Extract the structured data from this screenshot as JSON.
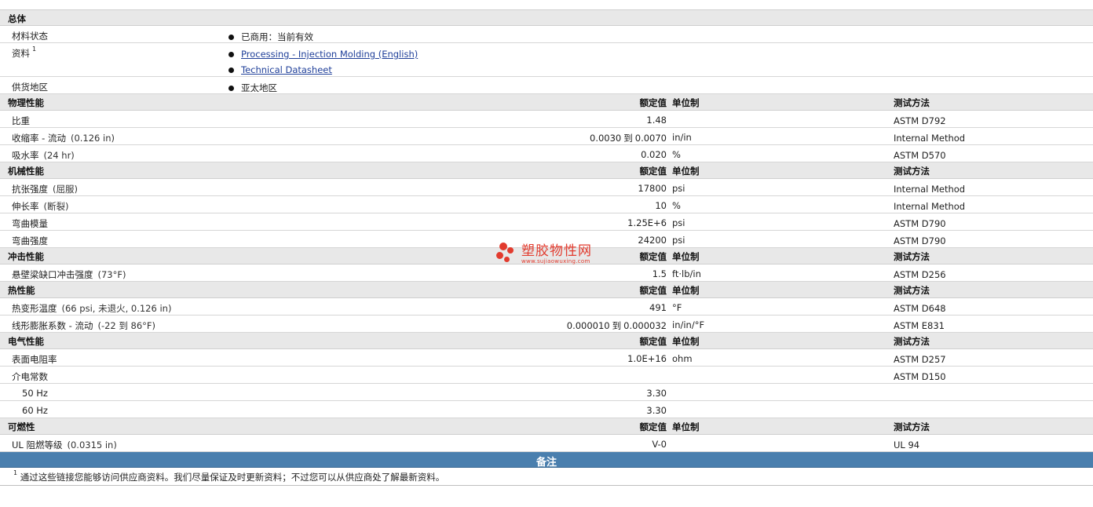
{
  "general": {
    "title": "总体",
    "material_status": {
      "label": "材料状态",
      "value": "已商用：当前有效"
    },
    "docs": {
      "label": "资料",
      "sup": "1",
      "links": [
        "Processing - Injection Molding (English)",
        "Technical Datasheet"
      ]
    },
    "supply": {
      "label": "供货地区",
      "value": "亚太地区"
    }
  },
  "headers": {
    "value": "额定值",
    "unit": "单位制",
    "test": "测试方法"
  },
  "physical": {
    "title": "物理性能",
    "rows": [
      {
        "label": "比重",
        "cond": "",
        "value": "1.48",
        "unit": "",
        "test": "ASTM D792"
      },
      {
        "label": "收缩率 - 流动",
        "cond": "(0.126 in)",
        "v1": "0.0030",
        "to": "到",
        "v2": "0.0070",
        "unit": "in/in",
        "test": "Internal Method"
      },
      {
        "label": "吸水率",
        "cond": "(24 hr)",
        "value": "0.020",
        "unit": "%",
        "test": "ASTM D570"
      }
    ]
  },
  "mechanical": {
    "title": "机械性能",
    "rows": [
      {
        "label": "抗张强度",
        "cond": "(屈服)",
        "value": "17800",
        "unit": "psi",
        "test": "Internal Method"
      },
      {
        "label": "伸长率",
        "cond": "(断裂)",
        "value": "10",
        "unit": "%",
        "test": "Internal Method"
      },
      {
        "label": "弯曲模量",
        "cond": "",
        "value": "1.25E+6",
        "unit": "psi",
        "test": "ASTM D790"
      },
      {
        "label": "弯曲强度",
        "cond": "",
        "value": "24200",
        "unit": "psi",
        "test": "ASTM D790"
      }
    ]
  },
  "impact": {
    "title": "冲击性能",
    "rows": [
      {
        "label": "悬壁梁缺口冲击强度",
        "cond": "(73°F)",
        "value": "1.5",
        "unit": "ft·lb/in",
        "test": "ASTM D256"
      }
    ]
  },
  "thermal": {
    "title": "热性能",
    "rows": [
      {
        "label": "热变形温度",
        "cond": "(66 psi, 未退火, 0.126 in)",
        "value": "491",
        "unit": "°F",
        "test": "ASTM D648"
      },
      {
        "label": "线形膨胀系数 - 流动",
        "cond": "(-22 到 86°F)",
        "v1": "0.000010",
        "to": "到",
        "v2": "0.000032",
        "unit": "in/in/°F",
        "test": "ASTM E831"
      }
    ]
  },
  "electrical": {
    "title": "电气性能",
    "resistivity": {
      "label": "表面电阻率",
      "value": "1.0E+16",
      "unit": "ohm",
      "test": "ASTM D257"
    },
    "dielectric": {
      "label": "介电常数",
      "test": "ASTM D150"
    },
    "sub": [
      {
        "label": "50 Hz",
        "value": "3.30"
      },
      {
        "label": "60 Hz",
        "value": "3.30"
      }
    ]
  },
  "flammability": {
    "title": "可燃性",
    "rows": [
      {
        "label": "UL 阻燃等级",
        "cond": "(0.0315 in)",
        "value": "V-0",
        "unit": "",
        "test": "UL 94"
      }
    ]
  },
  "notes": {
    "title": "备注",
    "sup": "1",
    "text": "通过这些链接您能够访问供应商资料。我们尽量保证及时更新资料；不过您可以从供应商处了解最新资料。"
  },
  "watermark": {
    "name": "塑胶物性网",
    "url": "www.sujiaowuxing.com"
  },
  "colors": {
    "section_bg": "#e8e8e8",
    "notes_bar": "#4a7fae",
    "link": "#1f3f99",
    "watermark": "#e23b2e"
  }
}
